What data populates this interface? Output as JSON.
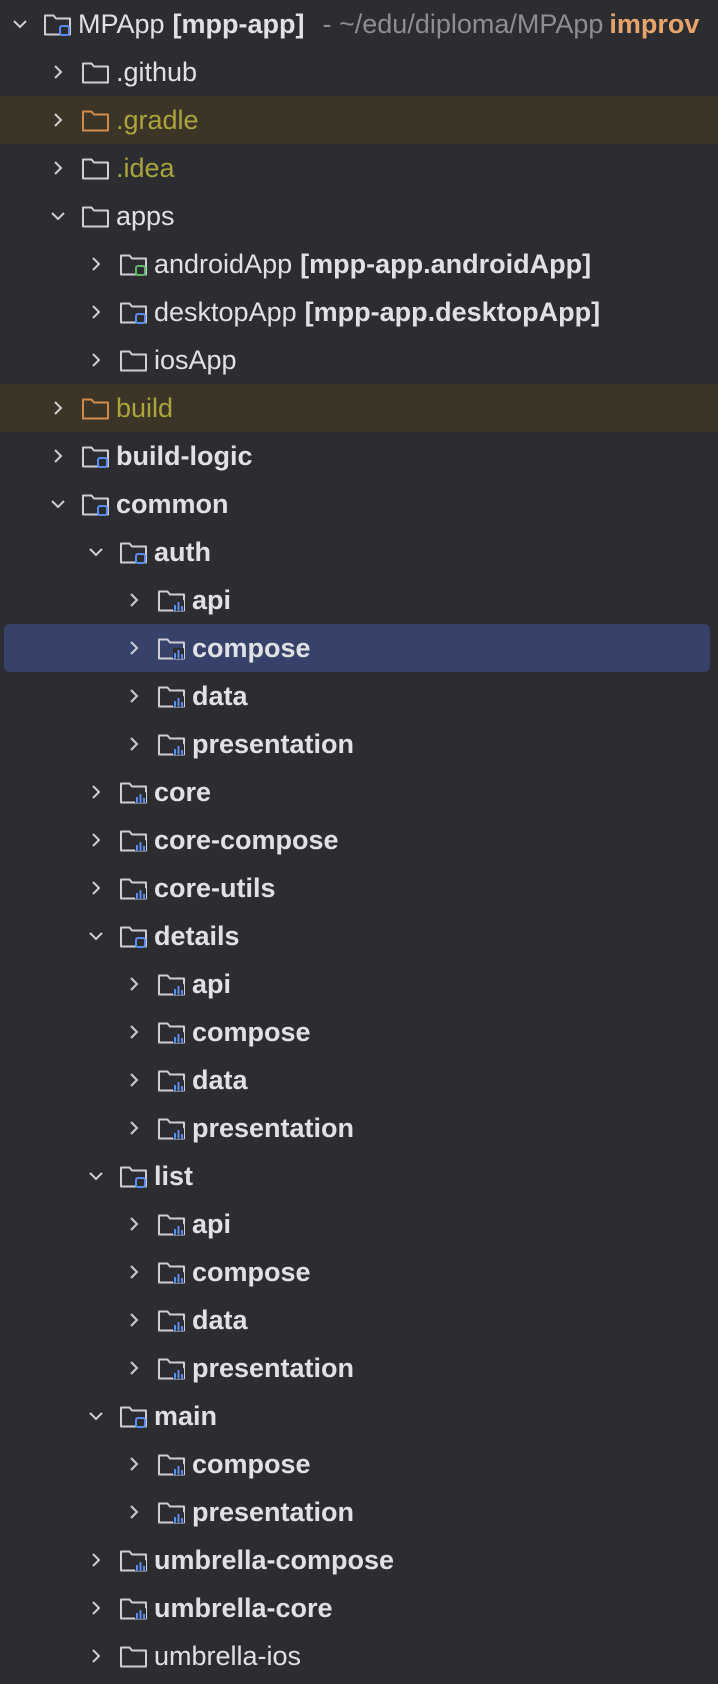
{
  "colors": {
    "background": "#2b2d30",
    "selection": "#36426a",
    "excluded_row": "#3d3428",
    "excluded_text": "#a9a53b",
    "excluded_folder": "#d08a4e",
    "module_badge": "#5a8cf0",
    "android_badge": "#5fb865",
    "hint": "#8c8e93",
    "branch": "#e8a46a"
  },
  "rows": [
    {
      "name": "MPApp",
      "qualifier": "[mpp-app]",
      "hint": "- ~/edu/diploma/MPApp",
      "branch": "improv",
      "depth": 0,
      "expanded": true,
      "icon": "module-folder-icon",
      "style": "normal"
    },
    {
      "name": ".github",
      "depth": 1,
      "expanded": false,
      "icon": "folder-icon",
      "style": "normal"
    },
    {
      "name": ".gradle",
      "depth": 1,
      "expanded": false,
      "icon": "excluded-folder-icon",
      "style": "excluded"
    },
    {
      "name": ".idea",
      "depth": 1,
      "expanded": false,
      "icon": "folder-icon",
      "style": "yellow"
    },
    {
      "name": "apps",
      "depth": 1,
      "expanded": true,
      "icon": "folder-icon",
      "style": "normal"
    },
    {
      "name": "androidApp",
      "qualifier": "[mpp-app.androidApp]",
      "depth": 2,
      "expanded": false,
      "icon": "android-module-folder-icon",
      "style": "normal"
    },
    {
      "name": "desktopApp",
      "qualifier": "[mpp-app.desktopApp]",
      "depth": 2,
      "expanded": false,
      "icon": "module-folder-icon",
      "style": "normal"
    },
    {
      "name": "iosApp",
      "depth": 2,
      "expanded": false,
      "icon": "folder-icon",
      "style": "normal"
    },
    {
      "name": "build",
      "depth": 1,
      "expanded": false,
      "icon": "excluded-folder-icon",
      "style": "excluded"
    },
    {
      "name": "build-logic",
      "depth": 1,
      "expanded": false,
      "icon": "module-folder-icon",
      "style": "bold"
    },
    {
      "name": "common",
      "depth": 1,
      "expanded": true,
      "icon": "module-folder-icon",
      "style": "bold"
    },
    {
      "name": "auth",
      "depth": 2,
      "expanded": true,
      "icon": "module-folder-icon",
      "style": "bold"
    },
    {
      "name": "api",
      "depth": 3,
      "expanded": false,
      "icon": "source-module-folder-icon",
      "style": "bold"
    },
    {
      "name": "compose",
      "depth": 3,
      "expanded": false,
      "icon": "source-module-folder-icon",
      "style": "bold",
      "selected": true
    },
    {
      "name": "data",
      "depth": 3,
      "expanded": false,
      "icon": "source-module-folder-icon",
      "style": "bold"
    },
    {
      "name": "presentation",
      "depth": 3,
      "expanded": false,
      "icon": "source-module-folder-icon",
      "style": "bold"
    },
    {
      "name": "core",
      "depth": 2,
      "expanded": false,
      "icon": "source-module-folder-icon",
      "style": "bold"
    },
    {
      "name": "core-compose",
      "depth": 2,
      "expanded": false,
      "icon": "source-module-folder-icon",
      "style": "bold"
    },
    {
      "name": "core-utils",
      "depth": 2,
      "expanded": false,
      "icon": "source-module-folder-icon",
      "style": "bold"
    },
    {
      "name": "details",
      "depth": 2,
      "expanded": true,
      "icon": "module-folder-icon",
      "style": "bold"
    },
    {
      "name": "api",
      "depth": 3,
      "expanded": false,
      "icon": "source-module-folder-icon",
      "style": "bold"
    },
    {
      "name": "compose",
      "depth": 3,
      "expanded": false,
      "icon": "source-module-folder-icon",
      "style": "bold"
    },
    {
      "name": "data",
      "depth": 3,
      "expanded": false,
      "icon": "source-module-folder-icon",
      "style": "bold"
    },
    {
      "name": "presentation",
      "depth": 3,
      "expanded": false,
      "icon": "source-module-folder-icon",
      "style": "bold"
    },
    {
      "name": "list",
      "depth": 2,
      "expanded": true,
      "icon": "module-folder-icon",
      "style": "bold"
    },
    {
      "name": "api",
      "depth": 3,
      "expanded": false,
      "icon": "source-module-folder-icon",
      "style": "bold"
    },
    {
      "name": "compose",
      "depth": 3,
      "expanded": false,
      "icon": "source-module-folder-icon",
      "style": "bold"
    },
    {
      "name": "data",
      "depth": 3,
      "expanded": false,
      "icon": "source-module-folder-icon",
      "style": "bold"
    },
    {
      "name": "presentation",
      "depth": 3,
      "expanded": false,
      "icon": "source-module-folder-icon",
      "style": "bold"
    },
    {
      "name": "main",
      "depth": 2,
      "expanded": true,
      "icon": "module-folder-icon",
      "style": "bold"
    },
    {
      "name": "compose",
      "depth": 3,
      "expanded": false,
      "icon": "source-module-folder-icon",
      "style": "bold"
    },
    {
      "name": "presentation",
      "depth": 3,
      "expanded": false,
      "icon": "source-module-folder-icon",
      "style": "bold"
    },
    {
      "name": "umbrella-compose",
      "depth": 2,
      "expanded": false,
      "icon": "source-module-folder-icon",
      "style": "bold"
    },
    {
      "name": "umbrella-core",
      "depth": 2,
      "expanded": false,
      "icon": "source-module-folder-icon",
      "style": "bold"
    },
    {
      "name": "umbrella-ios",
      "depth": 2,
      "expanded": false,
      "icon": "folder-icon",
      "style": "normal"
    }
  ]
}
